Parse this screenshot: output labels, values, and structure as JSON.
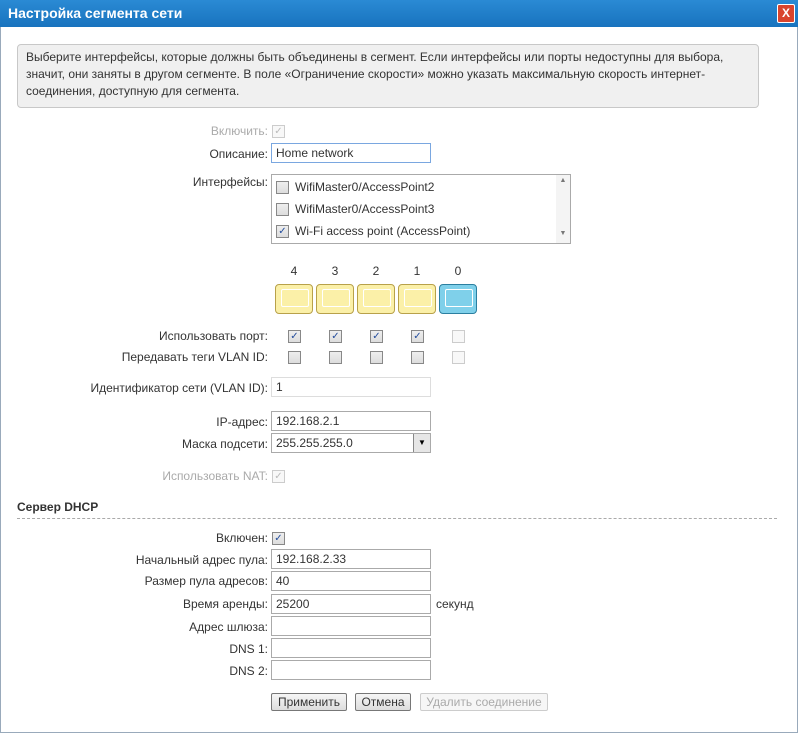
{
  "title": "Настройка сегмента сети",
  "close_label": "X",
  "info": "Выберите интерфейсы, которые должны быть объединены в сегмент. Если интерфейсы или порты недоступны для выбора, значит, они заняты в другом сегменте. В поле «Ограничение скорости» можно указать максимальную скорость интернет-соединения, доступную для сегмента.",
  "enable_label": "Включить:",
  "description_label": "Описание:",
  "description_value": "Home network",
  "interfaces_label": "Интерфейсы:",
  "interfaces": [
    {
      "label": "WifiMaster0/AccessPoint2",
      "checked": false
    },
    {
      "label": "WifiMaster0/AccessPoint3",
      "checked": false
    },
    {
      "label": "Wi-Fi access point (AccessPoint)",
      "checked": true
    }
  ],
  "ports": [
    "4",
    "3",
    "2",
    "1",
    "0"
  ],
  "use_port_label": "Использовать порт:",
  "vlan_tags_label": "Передавать теги VLAN ID:",
  "vlan_id_label": "Идентификатор сети (VLAN ID):",
  "vlan_id_value": "1",
  "ip_label": "IP-адрес:",
  "ip_value": "192.168.2.1",
  "mask_label": "Маска подсети:",
  "mask_value": "255.255.255.0",
  "nat_label": "Использовать NAT:",
  "dhcp": {
    "heading": "Сервер DHCP",
    "enabled_label": "Включен:",
    "start_label": "Начальный адрес пула:",
    "start_value": "192.168.2.33",
    "size_label": "Размер пула адресов:",
    "size_value": "40",
    "lease_label": "Время аренды:",
    "lease_value": "25200",
    "lease_unit": "секунд",
    "gateway_label": "Адрес шлюза:",
    "gateway_value": "",
    "dns1_label": "DNS 1:",
    "dns1_value": "",
    "dns2_label": "DNS 2:",
    "dns2_value": ""
  },
  "buttons": {
    "apply": "Применить",
    "cancel": "Отмена",
    "delete": "Удалить соединение"
  }
}
